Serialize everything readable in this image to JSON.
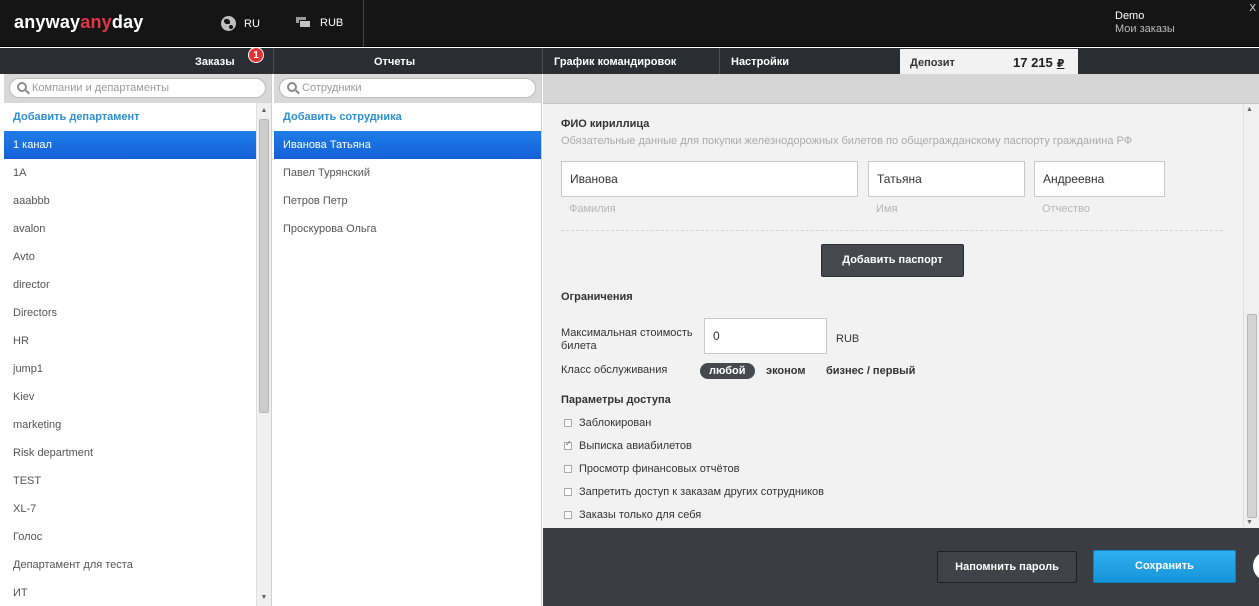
{
  "header": {
    "logo": {
      "part1": "anyway",
      "part2": "any",
      "part3": "day"
    },
    "language": "RU",
    "currency": "RUB",
    "user_name": "Demo",
    "user_link": "Мои заказы",
    "close": "X"
  },
  "nav": {
    "orders": "Заказы",
    "orders_badge": "1",
    "reports": "Отчеты",
    "schedule": "График командировок",
    "settings": "Настройки",
    "deposit_label": "Депозит",
    "deposit_amount": "17 215",
    "deposit_currency": "₽"
  },
  "left": {
    "search_placeholder": "Компании и департаменты",
    "add_label": "Добавить департамент",
    "items": [
      "1 канал",
      "1А",
      "aaabbb",
      "avalon",
      "Avto",
      "director",
      "Directors",
      "HR",
      "jump1",
      "Kiev",
      "marketing",
      "Risk department",
      "TEST",
      "XL-7",
      "Голос",
      "Департамент для теста",
      "ИТ"
    ]
  },
  "middle": {
    "search_placeholder": "Сотрудники",
    "add_label": "Добавить сотрудника",
    "items": [
      "Иванова Татьяна",
      "Павел Турянский",
      "Петров Петр",
      "Проскурова Ольга"
    ]
  },
  "form": {
    "fio_title": "ФИО кириллица",
    "fio_subtitle": "Обязательные данные для покупки железнодорожных билетов по общегражданскому паспорту гражданина РФ",
    "last_name": "Иванова",
    "last_name_caption": "Фамилия",
    "first_name": "Татьяна",
    "first_name_caption": "Имя",
    "middle_name": "Андреевна",
    "middle_name_caption": "Отчество",
    "add_passport": "Добавить паспорт",
    "limits_title": "Ограничения",
    "max_price_label_1": "Максимальная стоимость",
    "max_price_label_2": "билета",
    "max_price": "0",
    "max_price_currency": "RUB",
    "class_label": "Класс обслуживания",
    "class_any": "любой",
    "class_economy": "эконом",
    "class_business": "бизнес / первый",
    "access_title": "Параметры доступа",
    "permissions": [
      {
        "label": "Заблокирован",
        "checked": false
      },
      {
        "label": "Выписка авиабилетов",
        "checked": true
      },
      {
        "label": "Просмотр финансовых отчётов",
        "checked": false
      },
      {
        "label": "Запретить доступ к заказам других сотрудников",
        "checked": false
      },
      {
        "label": "Заказы только для себя",
        "checked": false
      }
    ]
  },
  "footer": {
    "remind_password": "Напомнить пароль",
    "save": "Сохранить"
  },
  "colors": {
    "topbar": "#151515",
    "nav": "#2a2d32",
    "selected_row": "#1f7de8",
    "link": "#2e8fd1",
    "brand_red": "#e1354a",
    "save_button": "#1694d8"
  }
}
